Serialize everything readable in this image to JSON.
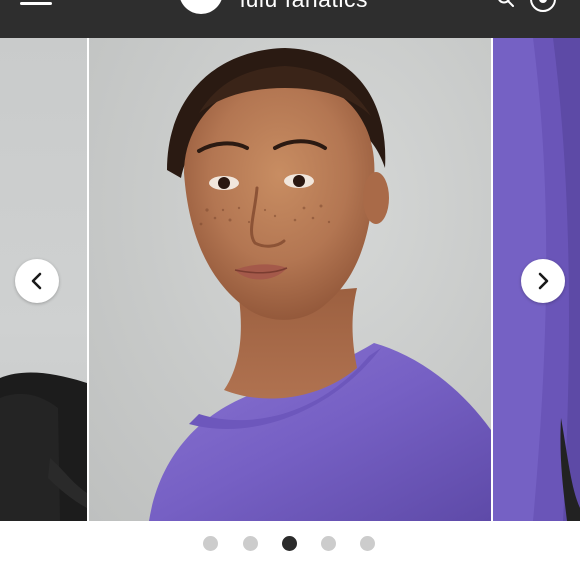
{
  "header": {
    "brand_title": "lulu fanatics",
    "icons": [
      "menu-icon",
      "logo-icon",
      "search-icon",
      "account-icon"
    ]
  },
  "carousel": {
    "slide_count": 5,
    "active_index": 2,
    "main_image": "woman-purple-sweatshirt",
    "prev_image": "black-top-partial",
    "next_image": "purple-sleeve-partial"
  },
  "colors": {
    "header_bg": "#2e2e2e",
    "sweatshirt_purple": "#7b66c6",
    "dot_active": "#2b2b2b",
    "dot_inactive": "#cccccc"
  }
}
